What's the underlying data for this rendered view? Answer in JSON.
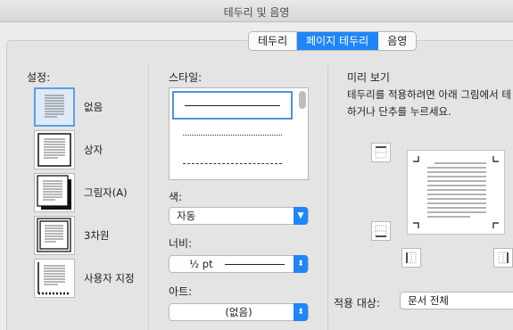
{
  "window": {
    "title": "테두리 및 음영"
  },
  "tabs": [
    {
      "label": "테두리",
      "active": false
    },
    {
      "label": "페이지 테두리",
      "active": true
    },
    {
      "label": "음영",
      "active": false
    }
  ],
  "settings": {
    "label": "설정:",
    "items": [
      {
        "label": "없음",
        "selected": true
      },
      {
        "label": "상자"
      },
      {
        "label": "그림자(A)"
      },
      {
        "label": "3차원"
      },
      {
        "label": "사용자 지정"
      }
    ]
  },
  "style": {
    "label": "스타일:",
    "options": [
      "solid",
      "dotted",
      "dashed"
    ]
  },
  "color": {
    "label": "색:",
    "value": "자동"
  },
  "width": {
    "label": "너비:",
    "value": "½ pt"
  },
  "art": {
    "label": "아트:",
    "value": "(없음)"
  },
  "preview": {
    "label": "미리 보기",
    "help_line1": "테두리를 적용하려면 아래 그림에서 테",
    "help_line2": "하거나 단추를 누르세요."
  },
  "apply_to": {
    "label": "적용 대상:",
    "value": "문서 전체"
  },
  "colors": {
    "accent": "#1f86f7",
    "selection": "#5b9fe8"
  }
}
